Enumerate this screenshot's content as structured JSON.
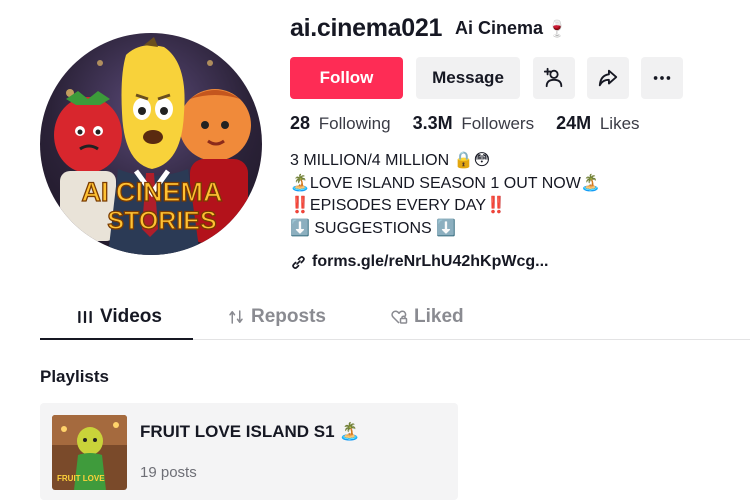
{
  "profile": {
    "username": "ai.cinema021",
    "nickname": "Ai Cinema",
    "nickname_icon": "🍷",
    "avatar_text_line1": "AI CINEMA",
    "avatar_text_line2": "STORIES"
  },
  "actions": {
    "follow_label": "Follow",
    "message_label": "Message"
  },
  "stats": {
    "following_count": "28",
    "following_label": "Following",
    "followers_count": "3.3M",
    "followers_label": "Followers",
    "likes_count": "24M",
    "likes_label": "Likes"
  },
  "bio": {
    "line1": "3 MILLION/4 MILLION 🔒😳",
    "line2": "🏝️LOVE ISLAND SEASON 1 OUT NOW🏝️",
    "line3": "‼️EPISODES EVERY DAY‼️",
    "line4": "⬇️ SUGGESTIONS ⬇️"
  },
  "link": {
    "text": "forms.gle/reNrLhU42hKpWcg..."
  },
  "tabs": [
    {
      "label": "Videos",
      "active": true
    },
    {
      "label": "Reposts",
      "active": false
    },
    {
      "label": "Liked",
      "active": false
    }
  ],
  "playlists": {
    "section_title": "Playlists",
    "items": [
      {
        "title": "FRUIT LOVE ISLAND S1 🏝️",
        "count": "19 posts",
        "thumb_text": "FRUIT LOVE"
      }
    ]
  },
  "colors": {
    "follow_bg": "#fe2c55",
    "button_bg": "#f1f1f2",
    "text_primary": "#161823",
    "text_secondary": "#8a8b91"
  },
  "icons": {
    "add_user": "add-user-icon",
    "share": "share-icon",
    "more": "more-dots-icon",
    "link": "link-icon",
    "videos": "grid-bars-icon",
    "reposts": "repost-icon",
    "liked": "heart-lock-icon"
  }
}
